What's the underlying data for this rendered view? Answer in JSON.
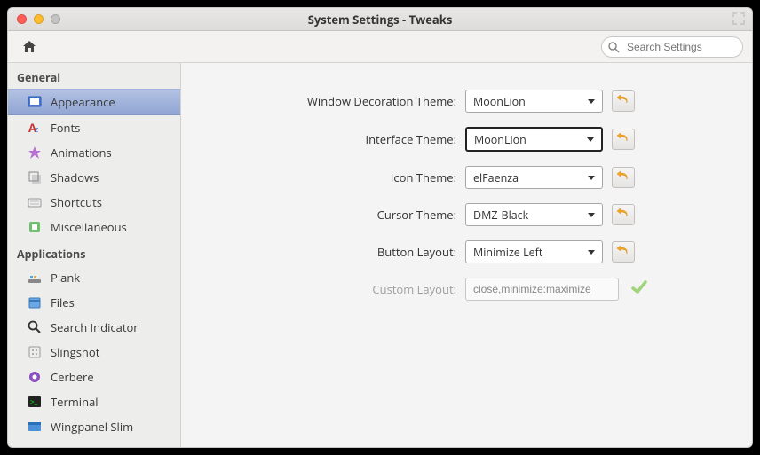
{
  "window": {
    "title": "System Settings - Tweaks"
  },
  "toolbar": {
    "search_placeholder": "Search Settings"
  },
  "sidebar": {
    "sections": [
      {
        "title": "General",
        "items": [
          {
            "label": "Appearance",
            "icon": "appearance",
            "selected": true
          },
          {
            "label": "Fonts",
            "icon": "fonts"
          },
          {
            "label": "Animations",
            "icon": "animations"
          },
          {
            "label": "Shadows",
            "icon": "shadows"
          },
          {
            "label": "Shortcuts",
            "icon": "shortcuts"
          },
          {
            "label": "Miscellaneous",
            "icon": "misc"
          }
        ]
      },
      {
        "title": "Applications",
        "items": [
          {
            "label": "Plank",
            "icon": "plank"
          },
          {
            "label": "Files",
            "icon": "files"
          },
          {
            "label": "Search Indicator",
            "icon": "search-indicator"
          },
          {
            "label": "Slingshot",
            "icon": "slingshot"
          },
          {
            "label": "Cerbere",
            "icon": "cerbere"
          },
          {
            "label": "Terminal",
            "icon": "terminal"
          },
          {
            "label": "Wingpanel Slim",
            "icon": "wingpanel"
          }
        ]
      }
    ]
  },
  "form": {
    "rows": [
      {
        "label": "Window Decoration Theme:",
        "value": "MoonLion",
        "type": "select"
      },
      {
        "label": "Interface Theme:",
        "value": "MoonLion",
        "type": "select",
        "focused": true
      },
      {
        "label": "Icon Theme:",
        "value": "elFaenza",
        "type": "select"
      },
      {
        "label": "Cursor Theme:",
        "value": "DMZ-Black",
        "type": "select"
      },
      {
        "label": "Button Layout:",
        "value": "Minimize Left",
        "type": "select"
      },
      {
        "label": "Custom Layout:",
        "value": "close,minimize:maximize",
        "type": "text",
        "disabled": true
      }
    ]
  }
}
